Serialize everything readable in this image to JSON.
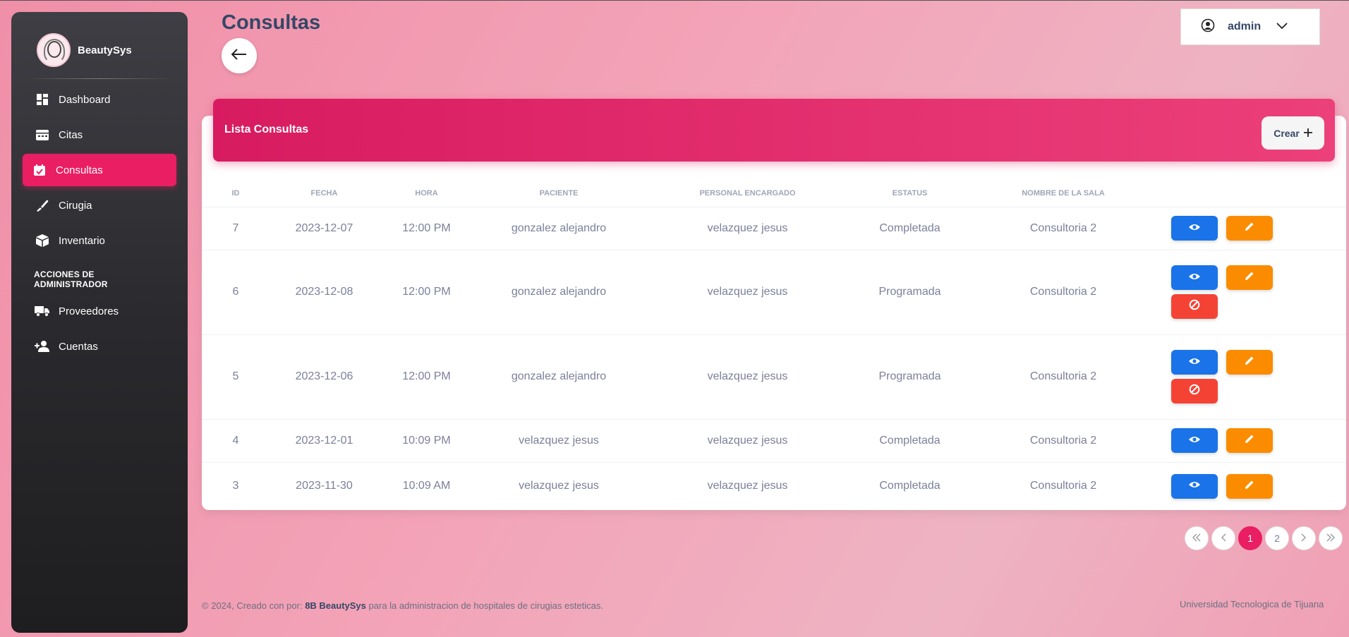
{
  "app": {
    "brand": "BeautySys"
  },
  "sidebar": {
    "items": [
      {
        "label": "Dashboard",
        "icon": "dashboard-icon"
      },
      {
        "label": "Citas",
        "icon": "calendar-icon"
      },
      {
        "label": "Consultas",
        "icon": "event-check-icon",
        "active": true
      },
      {
        "label": "Cirugia",
        "icon": "scalpel-icon"
      },
      {
        "label": "Inventario",
        "icon": "box-icon"
      }
    ],
    "admin_section": "ACCIONES DE ADMINISTRADOR",
    "admin_items": [
      {
        "label": "Proveedores",
        "icon": "truck-icon"
      },
      {
        "label": "Cuentas",
        "icon": "person-add-icon"
      }
    ]
  },
  "header": {
    "title": "Consultas",
    "back_icon": "arrow-left-icon"
  },
  "user": {
    "name": "admin",
    "icon": "user-circle-icon"
  },
  "card": {
    "title": "Lista Consultas",
    "create_label": "Crear"
  },
  "table": {
    "headers": [
      "ID",
      "FECHA",
      "HORA",
      "PACIENTE",
      "PERSONAL ENCARGADO",
      "ESTATUS",
      "NOMBRE DE LA SALA"
    ],
    "rows": [
      {
        "id": "7",
        "fecha": "2023-12-07",
        "hora": "12:00 PM",
        "paciente": "gonzalez alejandro",
        "personal": "velazquez jesus",
        "estatus": "Completada",
        "sala": "Consultoria 2"
      },
      {
        "id": "6",
        "fecha": "2023-12-08",
        "hora": "12:00 PM",
        "paciente": "gonzalez alejandro",
        "personal": "velazquez jesus",
        "estatus": "Programada",
        "sala": "Consultoria 2"
      },
      {
        "id": "5",
        "fecha": "2023-12-06",
        "hora": "12:00 PM",
        "paciente": "gonzalez alejandro",
        "personal": "velazquez jesus",
        "estatus": "Programada",
        "sala": "Consultoria 2"
      },
      {
        "id": "4",
        "fecha": "2023-12-01",
        "hora": "10:09 PM",
        "paciente": "velazquez jesus",
        "personal": "velazquez jesus",
        "estatus": "Completada",
        "sala": "Consultoria 2"
      },
      {
        "id": "3",
        "fecha": "2023-11-30",
        "hora": "10:09 AM",
        "paciente": "velazquez jesus",
        "personal": "velazquez jesus",
        "estatus": "Completada",
        "sala": "Consultoria 2"
      }
    ]
  },
  "pagination": {
    "pages": [
      "1",
      "2"
    ],
    "current": "1"
  },
  "footer": {
    "prefix": "© 2024, Creado con por:",
    "author": "8B BeautySys",
    "suffix": "para la administracion de hospitales de cirugias esteticas.",
    "right": "Universidad Tecnologica de Tijuana"
  },
  "colors": {
    "primary": "#e91e63",
    "view": "#1a73e8",
    "edit": "#fb8c00",
    "cancel": "#f44335",
    "sidebar": "#2a2a2e"
  }
}
